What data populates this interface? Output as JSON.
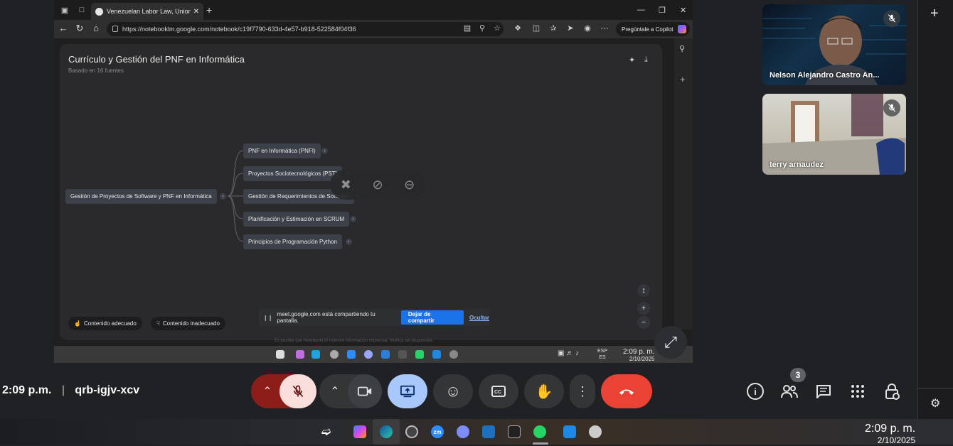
{
  "browser": {
    "tab_title": "Venezuelan Labor Law, Unions, a",
    "url": "https://notebooklm.google.com/notebook/c19f7790-633d-4e57-b918-522584f04f36",
    "copilot_label": "Pregúntale a Copilot"
  },
  "notebook": {
    "title": "Currículo y Gestión del PNF en Informática",
    "subtitle": "Basado en 16 fuentes",
    "root_node": "Gestión de Proyectos de Software y PNF en Informática",
    "child_nodes": [
      "PNF en Informática (PNFI)",
      "Proyectos Sociotecnológicos (PST)",
      "Gestión de Requerimientos de Software",
      "Planificación y Estimación en SCRUM",
      "Principios de Programación Python"
    ],
    "feedback_good": "Contenido adecuado",
    "feedback_bad": "Contenido inadecuado",
    "disclaimer": "Es posible que NotebookLM muestre información imprecisa. Verifica las respuestas."
  },
  "share_bar": {
    "message": "meet.google.com está compartiendo tu pantalla.",
    "stop_label": "Dejar de compartir",
    "hide_label": "Ocultar"
  },
  "inner_taskbar": {
    "lang_top": "ESP",
    "lang_bottom": "ES",
    "time": "2:09 p. m.",
    "date": "2/10/2025"
  },
  "participants": [
    {
      "name": "Nelson Alejandro Castro An..."
    },
    {
      "name": "terry arnaudez"
    }
  ],
  "meeting": {
    "time": "2:09 p.m.",
    "code": "qrb-igjv-xcv",
    "people_count": "3"
  },
  "taskbar": {
    "time": "2:09 p. m.",
    "date": "2/10/2025",
    "zoom_label": "zm"
  },
  "colors": {
    "end_call": "#ea4335",
    "present_active": "#a8c7fa",
    "mic_off_bg": "#f9dedc",
    "mic_arrow_bg": "#8c1d18",
    "stop_share": "#1a73e8"
  }
}
